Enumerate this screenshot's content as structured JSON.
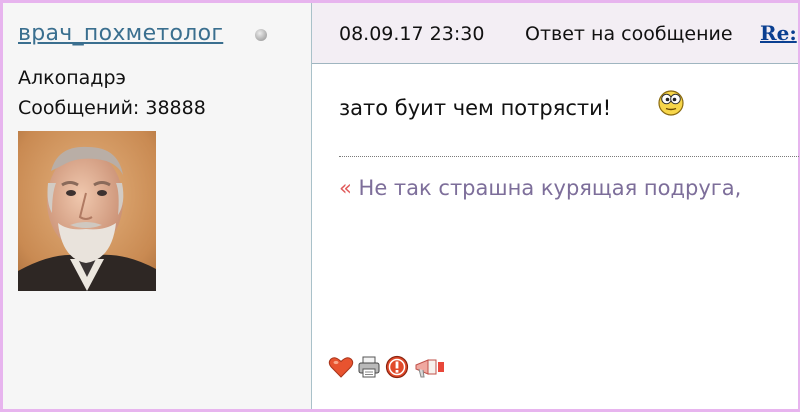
{
  "user": {
    "name": "врач_похметолог",
    "rank": "Алкопадрэ",
    "message_count": "Сообщений: 38888"
  },
  "post": {
    "date": "08.09.17 23:30",
    "reply_label": "Ответ на сообщение",
    "reply_link": "Re:",
    "text": "зато буит чем потрясти!",
    "signature_arrow": "«",
    "signature": "Не так страшна курящая подруга,"
  },
  "icons": {
    "status": "status-offline-icon",
    "smiley": "eyes-smiley-icon",
    "actions": [
      "heart-icon",
      "printer-icon",
      "warning-icon",
      "megaphone-icon"
    ]
  },
  "colors": {
    "frame": "#e7b4ee",
    "sidebar_bg": "#f6f6f6",
    "header_bg": "#f3eef4",
    "username": "#3a6f8f",
    "reply_link": "#0a3f91",
    "signature": "#7d6e9a",
    "signature_arrow": "#e05a5a"
  }
}
